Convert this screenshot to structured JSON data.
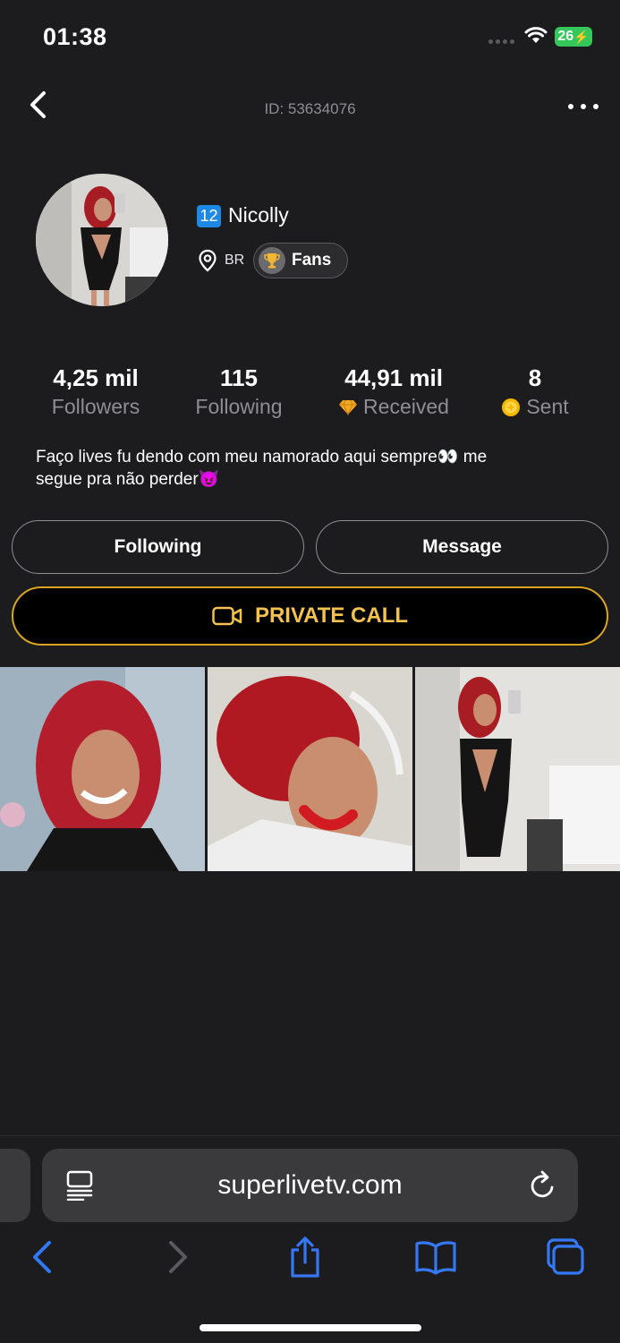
{
  "status_bar": {
    "time": "01:38",
    "battery": "26",
    "icons": [
      "cellular-signal-icon",
      "wifi-icon",
      "battery-charging-icon"
    ]
  },
  "nav": {
    "user_id": "ID: 53634076",
    "icons": [
      "chevron-left-icon",
      "more-dots-icon"
    ]
  },
  "profile": {
    "level": "12",
    "name": "Nicolly",
    "country": "BR",
    "fans_label": "Fans",
    "icons": [
      "location-pin-icon",
      "trophy-icon"
    ]
  },
  "stats": [
    {
      "value": "4,25 mil",
      "label": "Followers",
      "icon": ""
    },
    {
      "value": "115",
      "label": "Following",
      "icon": ""
    },
    {
      "value": "44,91 mil",
      "label": "Received",
      "icon": "diamond-icon"
    },
    {
      "value": "8",
      "label": "Sent",
      "icon": "coin-icon"
    }
  ],
  "bio": {
    "line1": "Faço lives fu dendo com meu namorado aqui sempre👀 me",
    "line2": "segue pra não perder😈"
  },
  "actions": {
    "following_label": "Following",
    "message_label": "Message",
    "private_call_label": "PRIVATE CALL"
  },
  "colors": {
    "background": "#1c1c1e",
    "accent_gold": "#f2c14e",
    "badge_blue": "#1e88e5",
    "battery_green": "#34c759",
    "safari_blue": "#3478f6"
  },
  "browser": {
    "url": "superlivetv.com",
    "icons": [
      "reader-icon",
      "reload-icon",
      "back-icon",
      "forward-icon",
      "share-icon",
      "bookmarks-icon",
      "tabs-icon"
    ]
  }
}
